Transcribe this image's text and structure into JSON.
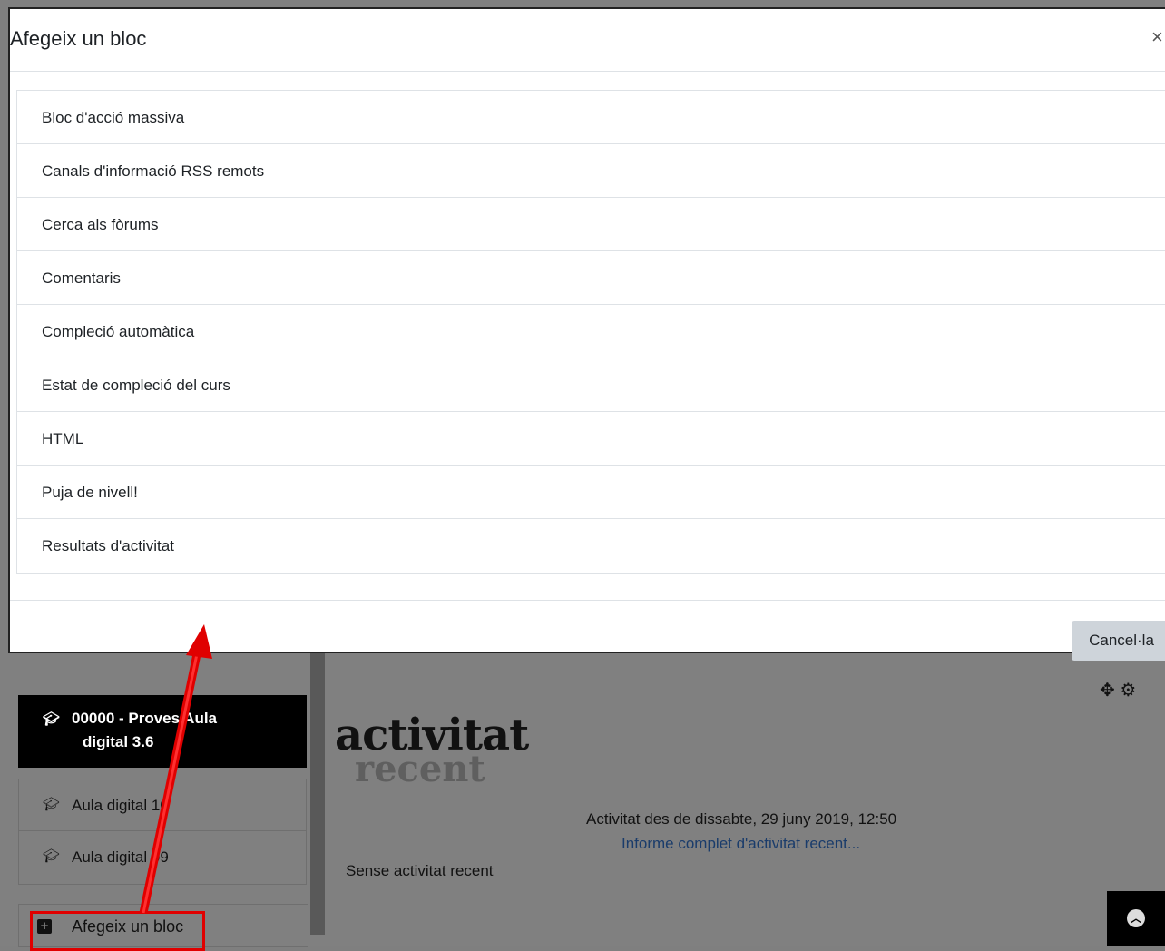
{
  "modal": {
    "title": "Afegeix un bloc",
    "close_glyph": "×",
    "items": [
      {
        "label": "Bloc d'acció massiva"
      },
      {
        "label": "Canals d'informació RSS remots"
      },
      {
        "label": "Cerca als fòrums"
      },
      {
        "label": "Comentaris"
      },
      {
        "label": "Compleció automàtica"
      },
      {
        "label": "Estat de compleció del curs"
      },
      {
        "label": "HTML"
      },
      {
        "label": "Puja de nivell!"
      },
      {
        "label": "Resultats d'activitat"
      }
    ],
    "cancel_label": "Cancel·la"
  },
  "sidebar": {
    "courses": [
      {
        "label": "00000 - Proves Aula digital 3.6",
        "line1": "00000 - Proves Aula",
        "line2": "digital 3.6",
        "active": true,
        "icon": "graduation-cap-icon"
      },
      {
        "label": "Aula digital 10",
        "active": false,
        "icon": "graduation-cap-icon"
      },
      {
        "label": "Aula digital 09",
        "active": false,
        "icon": "graduation-cap-icon"
      }
    ],
    "add_block_label": "Afegeix un bloc",
    "add_block_icon": "plus-square-icon"
  },
  "main": {
    "logo_main": "activitat",
    "logo_sub": "recent",
    "since_text": "Activitat des de dissabte, 29 juny 2019, 12:50",
    "report_link": "Informe complet d'activitat recent...",
    "no_activity": "Sense activitat recent"
  },
  "annotation_color": "#e00000"
}
